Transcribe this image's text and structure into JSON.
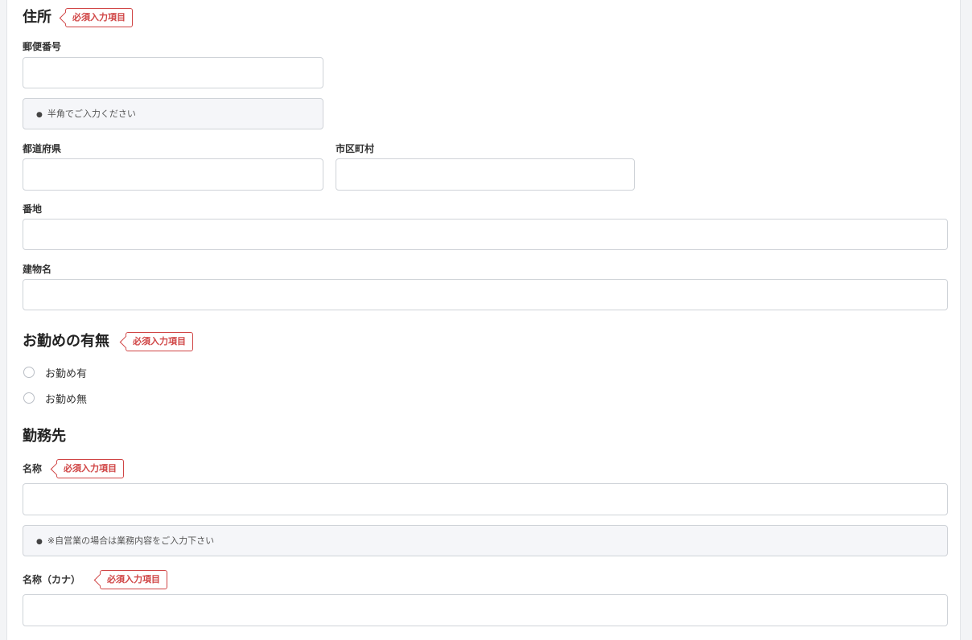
{
  "address": {
    "title": "住所",
    "required_badge": "必須入力項目",
    "postal_label": "郵便番号",
    "postal_value": "",
    "postal_note": "半角でご入力ください",
    "prefecture_label": "都道府県",
    "prefecture_value": "",
    "city_label": "市区町村",
    "city_value": "",
    "street_label": "番地",
    "street_value": "",
    "building_label": "建物名",
    "building_value": ""
  },
  "employment": {
    "title": "お勤めの有無",
    "required_badge": "必須入力項目",
    "options": [
      {
        "label": "お勤め有",
        "selected": false
      },
      {
        "label": "お勤め無",
        "selected": false
      }
    ]
  },
  "workplace": {
    "title": "勤務先",
    "name_label": "名称",
    "name_badge": "必須入力項目",
    "name_value": "",
    "name_note": "※自営業の場合は業務内容をご入力下さい",
    "kana_label": "名称（カナ）",
    "kana_badge": "必須入力項目",
    "kana_value": ""
  },
  "note_bullet": "●"
}
